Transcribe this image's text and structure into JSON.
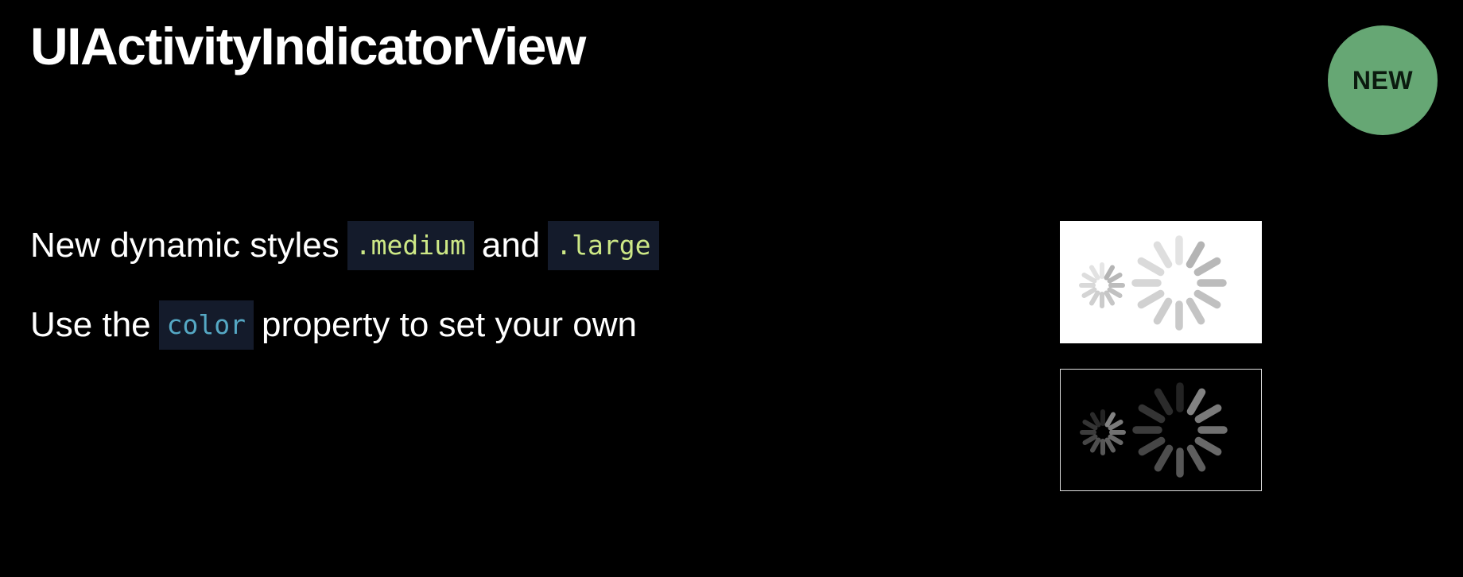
{
  "slide": {
    "title": "UIActivityIndicatorView",
    "badge": "NEW",
    "line1": {
      "text_before": "New dynamic styles",
      "code1": ".medium",
      "text_middle": "and",
      "code2": ".large"
    },
    "line2": {
      "text_before": "Use the",
      "code": "color",
      "text_after": "property to set your own"
    }
  },
  "colors": {
    "background": "#000000",
    "badge": "#66a774",
    "code_background": "#141b2b",
    "code_green": "#cde886",
    "code_blue": "#55a8c4",
    "spinner_light": "#b0b0b0",
    "spinner_dark": "#8a8a8a"
  },
  "spinners": [
    {
      "name": "spinner-light-panel",
      "theme": "light",
      "sizes": [
        "medium",
        "large"
      ]
    },
    {
      "name": "spinner-dark-panel",
      "theme": "dark",
      "sizes": [
        "medium",
        "large"
      ]
    }
  ]
}
